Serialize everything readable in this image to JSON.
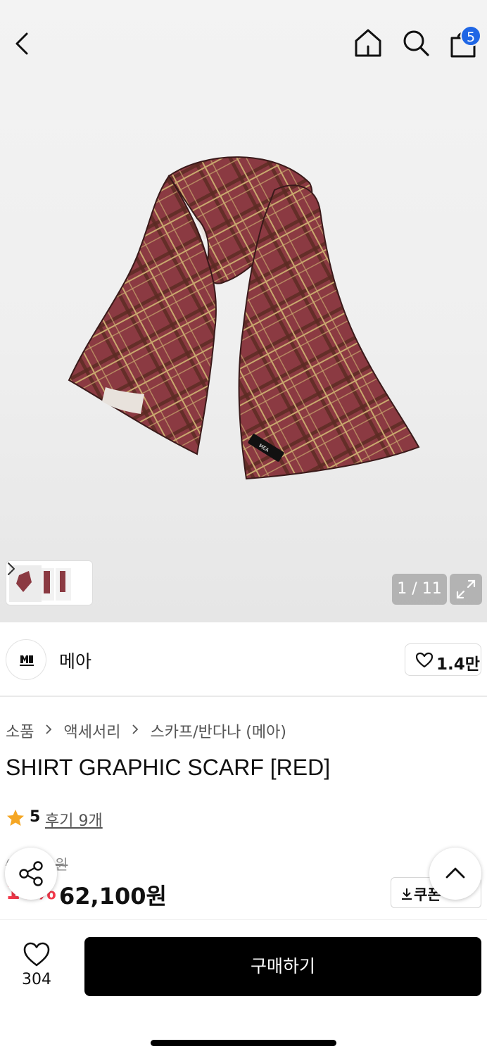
{
  "header": {
    "back_icon": "chevron-left-icon",
    "home_icon": "home-icon",
    "search_icon": "search-icon",
    "cart_icon": "shopping-bag-icon",
    "cart_badge": "5",
    "badge_color": "#1f66e5"
  },
  "gallery": {
    "counter": "1 / 11",
    "expand_icon": "expand-icon",
    "thumbnails_next_icon": "chevron-right-icon"
  },
  "brand": {
    "name": "메아",
    "like_icon": "heart-outline-icon",
    "like_count": "1.4만"
  },
  "breadcrumb": {
    "items": [
      "소품",
      "액세서리",
      "스카프/반다나 (메아)"
    ]
  },
  "product": {
    "title": "SHIRT GRAPHIC SCARF [RED]",
    "rating": "5",
    "reviews_label": "후기 9개",
    "original_price": "69,000원",
    "discount": "10%",
    "discount_color": "#f2384a",
    "price": "62,100원"
  },
  "actions": {
    "share_icon": "share-icon",
    "coupon_label": "쿠폰",
    "coupon_icon": "download-icon",
    "scroll_top_icon": "chevron-up-icon"
  },
  "bottom_bar": {
    "wishlist_icon": "heart-outline-icon",
    "wishlist_count": "304",
    "buy_label": "구매하기"
  }
}
